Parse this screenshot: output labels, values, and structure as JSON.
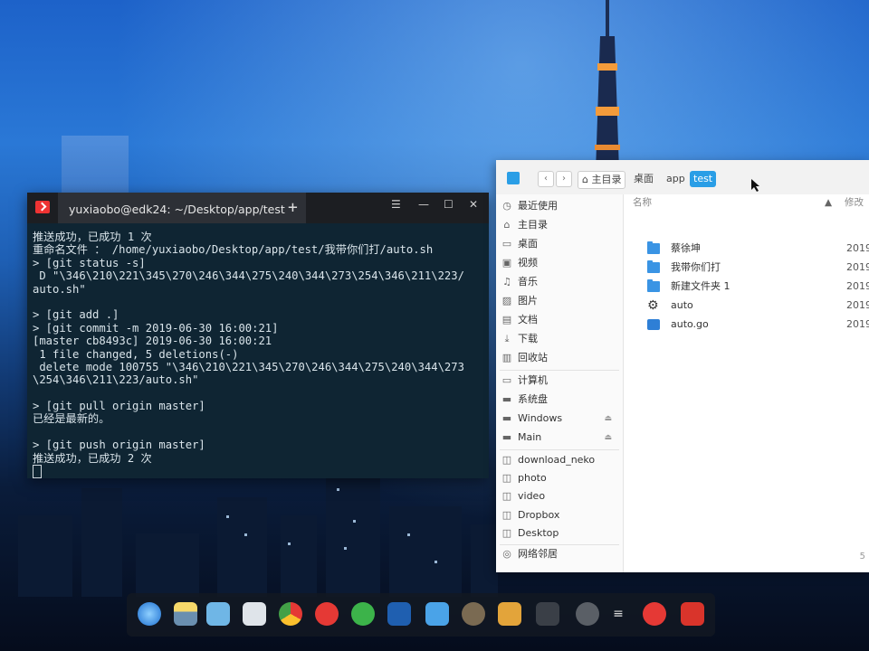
{
  "terminal": {
    "title": "yuxiaobo@edk24: ~/Desktop/app/test",
    "new_tab": "+",
    "lines": [
      "推送成功，已成功 1 次",
      "重命名文件 ： /home/yuxiaobo/Desktop/app/test/我带你们打/auto.sh",
      "> [git status -s]",
      " D \"\\346\\210\\221\\345\\270\\246\\344\\275\\240\\344\\273\\254\\346\\211\\223/",
      "auto.sh\"",
      "",
      "> [git add .]",
      "> [git commit -m 2019-06-30 16:00:21]",
      "[master cb8493c] 2019-06-30 16:00:21",
      " 1 file changed, 5 deletions(-)",
      " delete mode 100755 \"\\346\\210\\221\\345\\270\\246\\344\\275\\240\\344\\273",
      "\\254\\346\\211\\223/auto.sh\"",
      "",
      "> [git pull origin master]",
      "已经是最新的。",
      "",
      "> [git push origin master]",
      "推送成功，已成功 2 次"
    ]
  },
  "file_manager": {
    "breadcrumbs": [
      "主目录",
      "桌面",
      "app",
      "test"
    ],
    "sidebar": [
      {
        "label": "最近使用",
        "icon": "clock-icon"
      },
      {
        "label": "主目录",
        "icon": "home-icon"
      },
      {
        "label": "桌面",
        "icon": "desktop-icon"
      },
      {
        "label": "视频",
        "icon": "video-icon"
      },
      {
        "label": "音乐",
        "icon": "music-icon"
      },
      {
        "label": "图片",
        "icon": "picture-icon"
      },
      {
        "label": "文档",
        "icon": "document-icon"
      },
      {
        "label": "下载",
        "icon": "download-icon"
      },
      {
        "label": "回收站",
        "icon": "trash-icon"
      },
      {
        "label": "计算机",
        "icon": "computer-icon"
      },
      {
        "label": "系统盘",
        "icon": "disk-icon"
      },
      {
        "label": "Windows",
        "icon": "disk-icon"
      },
      {
        "label": "Main",
        "icon": "disk-icon"
      },
      {
        "label": "download_neko",
        "icon": "bookmark-icon"
      },
      {
        "label": "photo",
        "icon": "bookmark-icon"
      },
      {
        "label": "video",
        "icon": "bookmark-icon"
      },
      {
        "label": "Dropbox",
        "icon": "bookmark-icon"
      },
      {
        "label": "Desktop",
        "icon": "bookmark-icon"
      },
      {
        "label": "网络邻居",
        "icon": "network-icon"
      }
    ],
    "columns": {
      "name": "名称",
      "modified": "修改"
    },
    "files": [
      {
        "name": "蔡徐坤",
        "type": "folder",
        "date": "2019"
      },
      {
        "name": "我带你们打",
        "type": "folder",
        "date": "2019"
      },
      {
        "name": "新建文件夹 1",
        "type": "folder",
        "date": "2019"
      },
      {
        "name": "auto",
        "type": "gear",
        "date": "2019"
      },
      {
        "name": "auto.go",
        "type": "go",
        "date": "2019"
      }
    ],
    "status": "5"
  },
  "dock": [
    "launcher-icon",
    "file-manager-icon",
    "multitask-icon",
    "app-store-icon",
    "chrome-icon",
    "netease-music-icon",
    "wechat-icon",
    "vscode-icon",
    "sticky-note-icon",
    "gimp-icon",
    "sublime-icon",
    "terminal-icon",
    "arrow-icon",
    "menu-icon",
    "power-icon",
    "trash-icon"
  ]
}
